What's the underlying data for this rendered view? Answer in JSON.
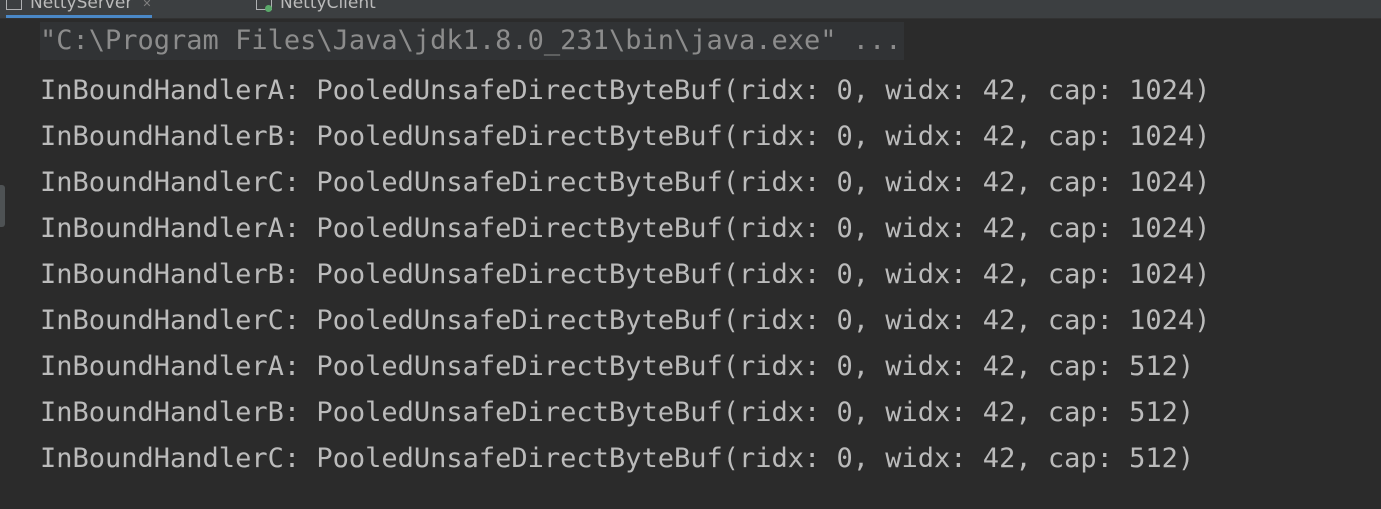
{
  "tabs": [
    {
      "label": "NettyServer",
      "icon": "application-icon",
      "active": true
    },
    {
      "label": "NettyClient",
      "icon": "application-running-icon",
      "active": false
    }
  ],
  "console": {
    "command": "\"C:\\Program Files\\Java\\jdk1.8.0_231\\bin\\java.exe\" ...",
    "lines": [
      "InBoundHandlerA: PooledUnsafeDirectByteBuf(ridx: 0, widx: 42, cap: 1024)",
      "InBoundHandlerB: PooledUnsafeDirectByteBuf(ridx: 0, widx: 42, cap: 1024)",
      "InBoundHandlerC: PooledUnsafeDirectByteBuf(ridx: 0, widx: 42, cap: 1024)",
      "InBoundHandlerA: PooledUnsafeDirectByteBuf(ridx: 0, widx: 42, cap: 1024)",
      "InBoundHandlerB: PooledUnsafeDirectByteBuf(ridx: 0, widx: 42, cap: 1024)",
      "InBoundHandlerC: PooledUnsafeDirectByteBuf(ridx: 0, widx: 42, cap: 1024)",
      "InBoundHandlerA: PooledUnsafeDirectByteBuf(ridx: 0, widx: 42, cap: 512)",
      "InBoundHandlerB: PooledUnsafeDirectByteBuf(ridx: 0, widx: 42, cap: 512)",
      "InBoundHandlerC: PooledUnsafeDirectByteBuf(ridx: 0, widx: 42, cap: 512)"
    ]
  },
  "colors": {
    "background": "#2b2b2b",
    "text": "#bbbbbb",
    "command_text": "#8c8c8c",
    "tab_accent": "#4a88c7"
  }
}
